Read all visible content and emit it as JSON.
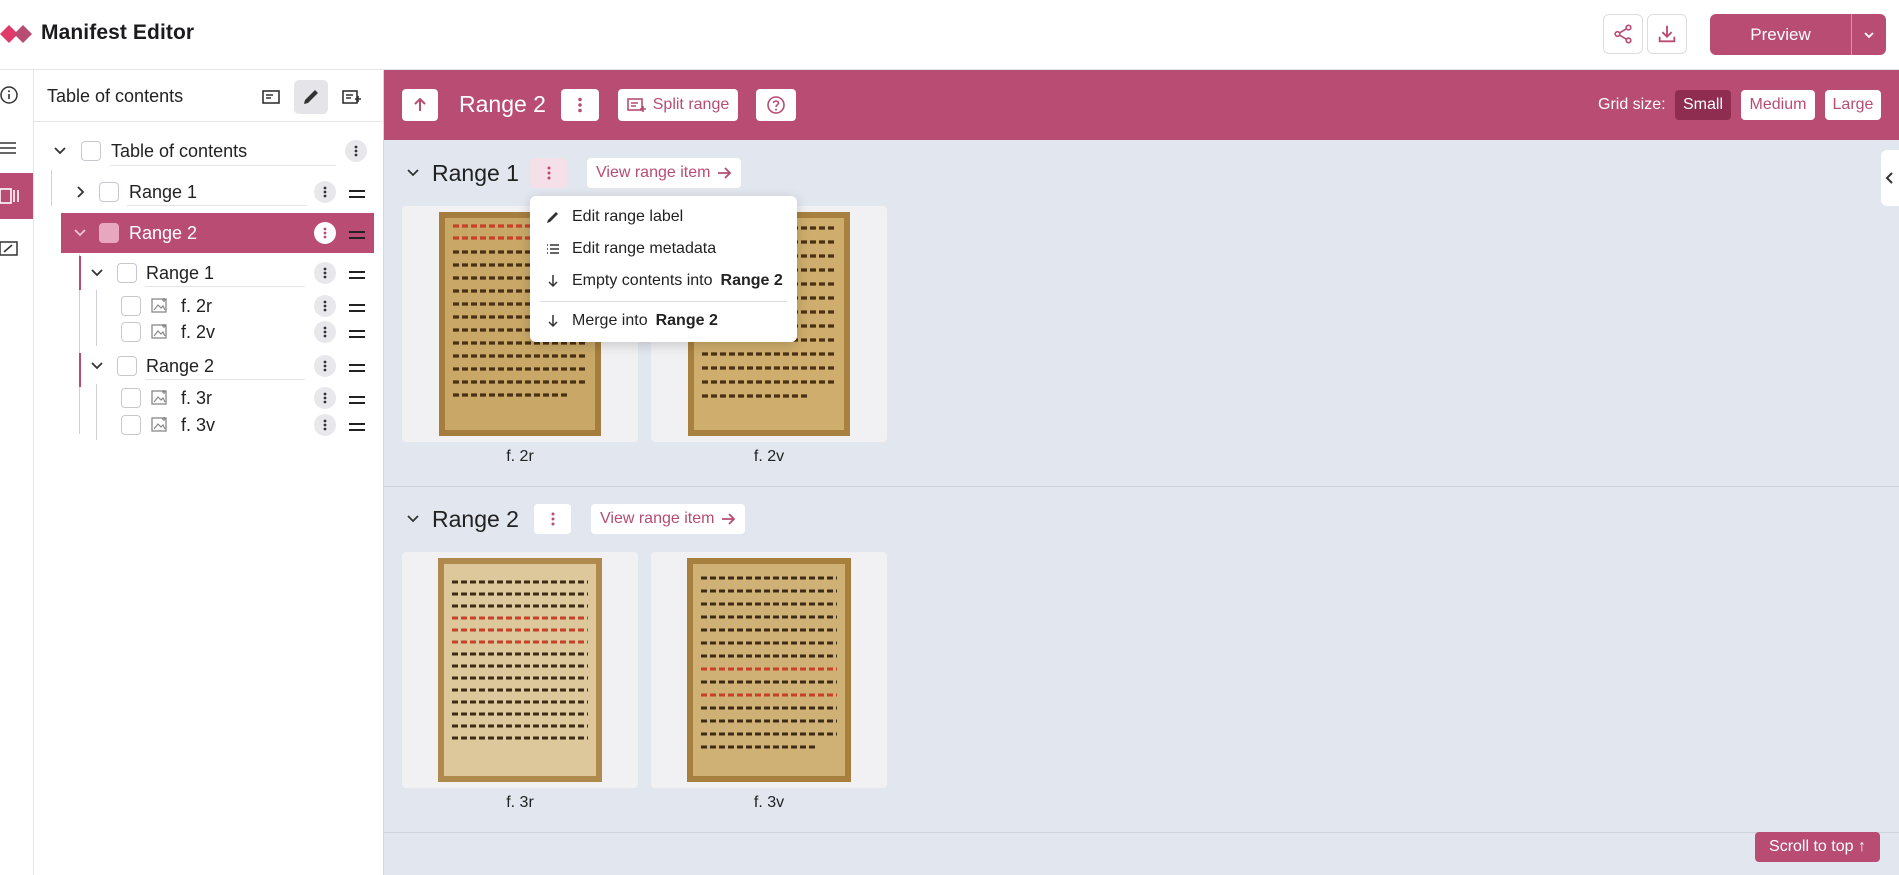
{
  "app": {
    "title": "Manifest Editor",
    "preview_label": "Preview",
    "brand_color": "#b84c73"
  },
  "toc": {
    "title": "Table of contents",
    "root_label": "Table of contents",
    "items": [
      {
        "label": "Range 1"
      },
      {
        "label": "Range 2"
      },
      {
        "label": "Range 1"
      },
      {
        "label": "f. 2r"
      },
      {
        "label": "f. 2v"
      },
      {
        "label": "Range 2"
      },
      {
        "label": "f. 3r"
      },
      {
        "label": "f. 3v"
      }
    ]
  },
  "range_bar": {
    "title": "Range 2",
    "split_label": "Split range",
    "grid_label": "Grid size:",
    "grid_options": [
      "Small",
      "Medium",
      "Large"
    ],
    "grid_selected": "Small"
  },
  "sections": [
    {
      "title": "Range 1",
      "view_label": "View range item",
      "cards": [
        {
          "label": "f. 2r"
        },
        {
          "label": "f. 2v"
        }
      ]
    },
    {
      "title": "Range 2",
      "view_label": "View range item",
      "cards": [
        {
          "label": "f. 3r"
        },
        {
          "label": "f. 3v"
        }
      ]
    }
  ],
  "menu": {
    "items": [
      {
        "label": "Edit range label",
        "icon": "pencil-icon"
      },
      {
        "label": "Edit range metadata",
        "icon": "list-icon"
      },
      {
        "label": "Empty contents into",
        "target": "Range 2",
        "icon": "arrow-down-icon"
      },
      {
        "label": "Merge into",
        "target": "Range 2",
        "icon": "arrow-down-icon"
      }
    ]
  },
  "scroll_top_label": "Scroll to top ↑"
}
